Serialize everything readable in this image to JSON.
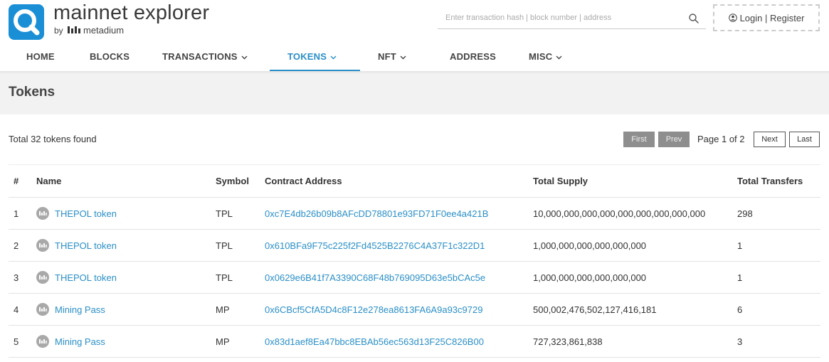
{
  "brand": {
    "title": "mainnet explorer",
    "by": "by",
    "company": "metadium",
    "color": "#1a8fd6"
  },
  "search": {
    "placeholder": "Enter transaction hash | block number | address",
    "value": ""
  },
  "auth": {
    "label": "Login | Register"
  },
  "nav": {
    "items": [
      {
        "label": "HOME"
      },
      {
        "label": "BLOCKS"
      },
      {
        "label": "TRANSACTIONS"
      },
      {
        "label": "TOKENS"
      },
      {
        "label": "NFT"
      },
      {
        "label": "ADDRESS"
      },
      {
        "label": "MISC"
      }
    ],
    "active": "TOKENS",
    "accent": "#2a8fc8"
  },
  "page": {
    "title": "Tokens",
    "total": "Total 32 tokens found"
  },
  "pagination": {
    "first": "First",
    "prev": "Prev",
    "info": "Page 1 of 2",
    "next": "Next",
    "last": "Last"
  },
  "table": {
    "headers": {
      "index": "#",
      "name": "Name",
      "symbol": "Symbol",
      "address": "Contract Address",
      "supply": "Total Supply",
      "transfers": "Total Transfers"
    },
    "rows": [
      {
        "index": "1",
        "name": "THEPOL token",
        "symbol": "TPL",
        "address": "0xc7E4db26b09b8AFcDD78801e93FD71F0ee4a421B",
        "supply": "10,000,000,000,000,000,000,000,000,000",
        "transfers": "298"
      },
      {
        "index": "2",
        "name": "THEPOL token",
        "symbol": "TPL",
        "address": "0x610BFa9F75c225f2Fd4525B2276C4A37F1c322D1",
        "supply": "1,000,000,000,000,000,000",
        "transfers": "1"
      },
      {
        "index": "3",
        "name": "THEPOL token",
        "symbol": "TPL",
        "address": "0x0629e6B41f7A3390C68F48b769095D63e5bCAc5e",
        "supply": "1,000,000,000,000,000,000",
        "transfers": "1"
      },
      {
        "index": "4",
        "name": "Mining Pass",
        "symbol": "MP",
        "address": "0x6CBcf5CfA5D4c8F12e278ea8613FA6A9a93c9729",
        "supply": "500,002,476,502,127,416,181",
        "transfers": "6"
      },
      {
        "index": "5",
        "name": "Mining Pass",
        "symbol": "MP",
        "address": "0x83d1aef8Ea47bbc8EBAb56ec563d13F25C826B00",
        "supply": "727,323,861,838",
        "transfers": "3"
      }
    ]
  }
}
